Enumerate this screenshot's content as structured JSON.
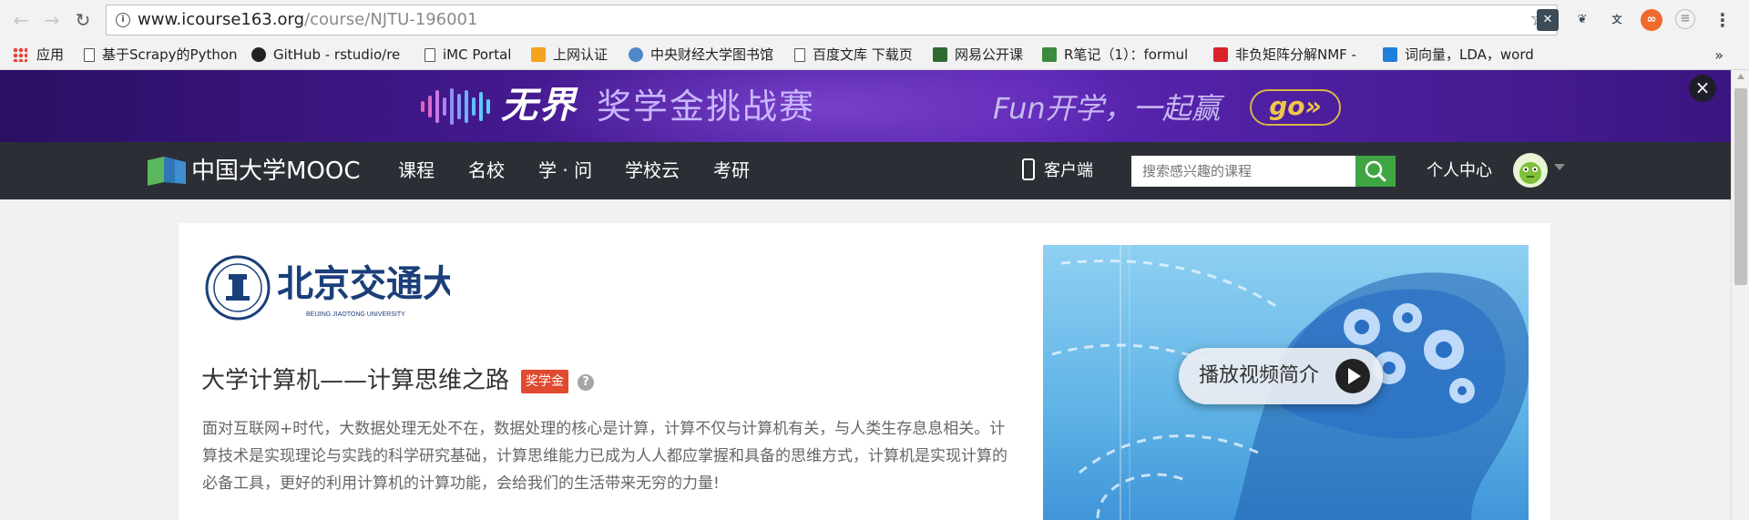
{
  "browser": {
    "url_host": "www.icourse163.org",
    "url_path": "/course/NJTU-196001",
    "bookmarks": [
      {
        "label": "应用",
        "icon": "apps-icon"
      },
      {
        "label": "基于Scrapy的Python",
        "icon": "page-icon"
      },
      {
        "label": "GitHub - rstudio/re",
        "icon": "github-icon"
      },
      {
        "label": "iMC Portal",
        "icon": "page-icon"
      },
      {
        "label": "上网认证",
        "icon": "ep-icon"
      },
      {
        "label": "中央财经大学图书馆",
        "icon": "library-icon"
      },
      {
        "label": "百度文库 下载页",
        "icon": "page-icon"
      },
      {
        "label": "网易公开课",
        "icon": "netease-open-icon"
      },
      {
        "label": "R笔记（1）：formul",
        "icon": "r-notes-icon"
      },
      {
        "label": "非负矩阵分解NMF -",
        "icon": "c-icon"
      },
      {
        "label": "词向量，LDA，word",
        "icon": "zhihu-icon"
      }
    ],
    "bookmarks_overflow": "»"
  },
  "banner": {
    "title_main": "无界",
    "title_sub": "奖学金挑战赛",
    "slogan": "Fun开学，一起赢",
    "go_label": "go»",
    "close_label": "×"
  },
  "header": {
    "logo_text": "中国大学MOOC",
    "nav": [
      "课程",
      "名校",
      "学 · 问",
      "学校云",
      "考研"
    ],
    "client_label": "客户端",
    "search_placeholder": "搜索感兴趣的课程",
    "user_center": "个人中心"
  },
  "course": {
    "university_en": "BEIJING JIAOTONG UNIVERSITY",
    "university_cn": "北京交通大學",
    "title": "大学计算机——计算思维之路",
    "badge": "奖学金",
    "help": "?",
    "description": "面对互联网+时代，大数据处理无处不在，数据处理的核心是计算，计算不仅与计算机有关，与人类生存息息相关。计算技术是实现理论与实践的科学研究基础，计算思维能力已成为人人都应掌握和具备的思维方式，计算机是实现计算的必备工具，更好的利用计算机的计算功能，会给我们的生活带来无穷的力量!",
    "video_label": "播放视频简介"
  },
  "colors": {
    "header_bg": "#2b2f35",
    "search_btn": "#3ea542",
    "badge_bg": "#e04a2f",
    "banner_bg": "#43198f",
    "go_color": "#f0c64a"
  }
}
